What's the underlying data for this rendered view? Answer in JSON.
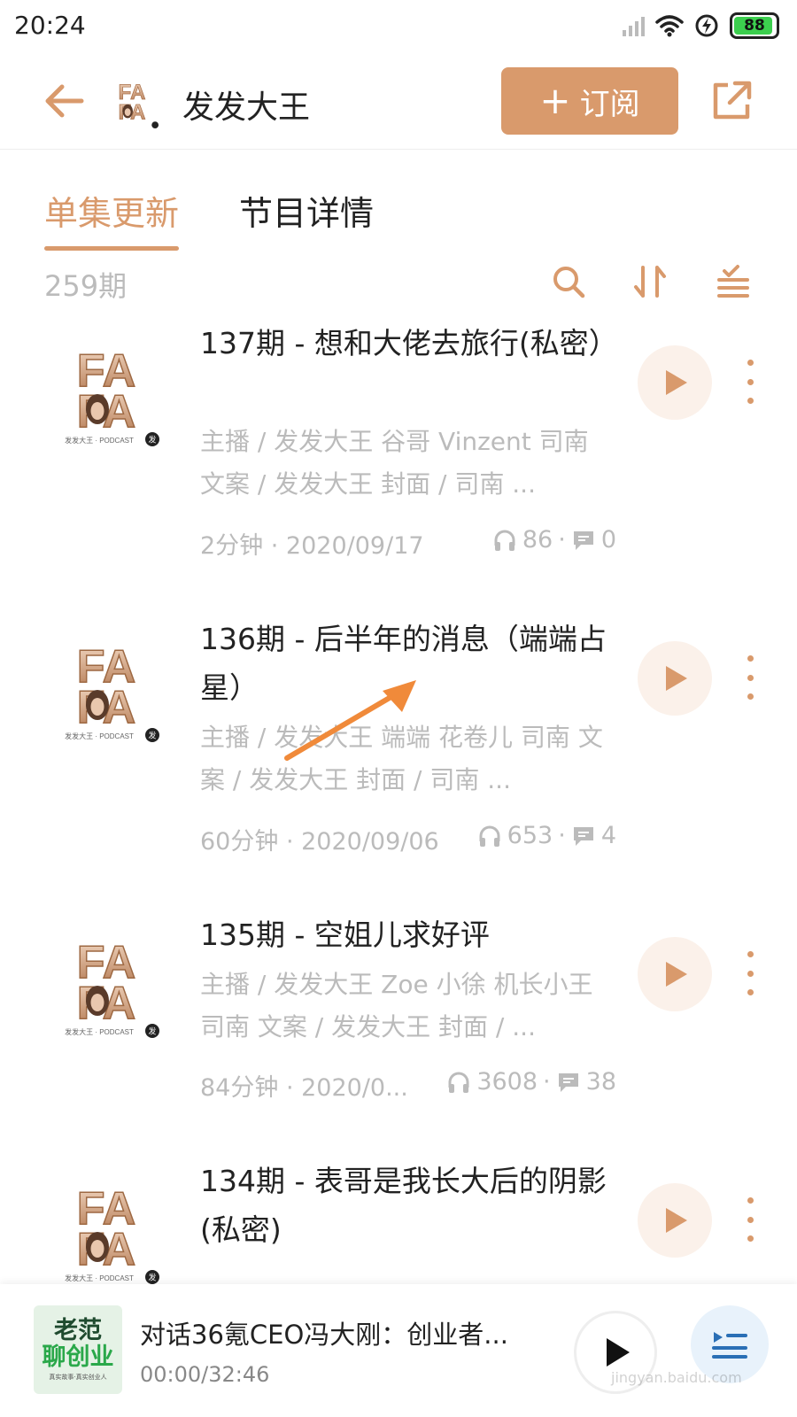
{
  "status_bar": {
    "time": "20:24",
    "battery": "88"
  },
  "header": {
    "title": "发发大王",
    "subscribe_label": "订阅",
    "subscribe_plus": "+"
  },
  "tabs": [
    {
      "label": "单集更新"
    },
    {
      "label": "节目详情"
    }
  ],
  "toolbar": {
    "count": "259期"
  },
  "episodes": [
    {
      "title": "137期 - 想和大佬去旅行(私密）",
      "hosts": "主播 / 发发大王 谷哥 Vinzent 司南 文案 / 发发大王 封面 / 司南 ...",
      "duration_date": "2分钟 · 2020/09/17",
      "plays": "86",
      "comments": "0"
    },
    {
      "title": "136期 - 后半年的消息（端端占星）",
      "hosts": "主播 / 发发大王 端端 花卷儿 司南 文案 / 发发大王 封面 / 司南 ...",
      "duration_date": "60分钟 · 2020/09/06",
      "plays": "653",
      "comments": "4"
    },
    {
      "title": "135期 - 空姐儿求好评",
      "hosts": "主播 / 发发大王 Zoe 小徐 机长小王 司南 文案 / 发发大王 封面 / ...",
      "duration_date": "84分钟 · 2020/0...",
      "plays": "3608",
      "comments": "38"
    },
    {
      "title": "134期 - 表哥是我长大后的阴影(私密)"
    }
  ],
  "cover_logo": {
    "line1": "FA",
    "line2": "FA",
    "caption": "发发大王 · PODCAST",
    "badge": "发"
  },
  "player": {
    "title": "对话36氪CEO冯大刚：创业者...",
    "time": "00:00/32:46",
    "cover_line1": "老范",
    "cover_line2": "聊创业",
    "cover_line3": "真实故事·真实创业人"
  },
  "watermark": "jingyan.baidu.com",
  "colors": {
    "accent": "#d99a6c",
    "muted": "#bbbbbb",
    "play_bg": "#fbf1ea"
  },
  "icons": [
    "back-arrow-icon",
    "share-icon",
    "search-icon",
    "sort-icon",
    "filter-list-icon",
    "headphones-icon",
    "comment-icon",
    "play-icon",
    "more-vertical-icon",
    "playlist-icon",
    "wifi-icon",
    "signal-icon",
    "charging-icon"
  ]
}
